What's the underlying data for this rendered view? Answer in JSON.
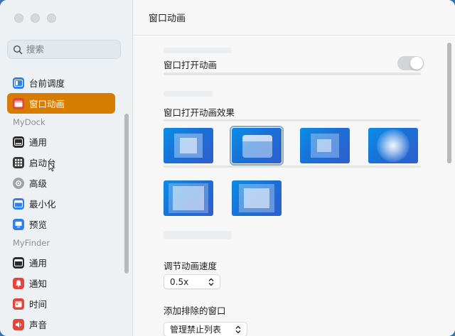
{
  "sidebar": {
    "search_placeholder": "搜索",
    "items_top": [
      {
        "label": "台前调度",
        "icon": "stage-manager-icon",
        "color": "#2f80e8"
      },
      {
        "label": "窗口动画",
        "icon": "window-animation-icon",
        "color": "#e2453c",
        "active": true
      }
    ],
    "section_mydock": "MyDock",
    "items_dock": [
      {
        "label": "通用",
        "icon": "general-icon",
        "color": "#2b2b2b"
      },
      {
        "label": "启动台",
        "icon": "launchpad-icon",
        "color": "#3a3a3a"
      },
      {
        "label": "高级",
        "icon": "advanced-icon",
        "color": "#9ea3a8"
      },
      {
        "label": "最小化",
        "icon": "minimize-icon",
        "color": "#2f80e8"
      },
      {
        "label": "预览",
        "icon": "preview-icon",
        "color": "#2f80e8"
      }
    ],
    "section_myfinder": "MyFinder",
    "items_finder": [
      {
        "label": "通用",
        "icon": "general-icon",
        "color": "#2b2b2b"
      },
      {
        "label": "通知",
        "icon": "notification-icon",
        "color": "#e2453c"
      },
      {
        "label": "时间",
        "icon": "clock-icon",
        "color": "#e2453c"
      },
      {
        "label": "声音",
        "icon": "sound-icon",
        "color": "#e2453c"
      }
    ],
    "accent": "#d67c00"
  },
  "main": {
    "title": "窗口动画",
    "open_animation_label": "窗口打开动画",
    "open_animation_enabled": true,
    "open_effect_label": "窗口打开动画效果",
    "effects_count_selected_index": 1,
    "speed_label": "调节动画速度",
    "speed_value": "0.5x",
    "exclude_label": "添加排除的窗口",
    "exclude_button": "管理禁止列表"
  }
}
